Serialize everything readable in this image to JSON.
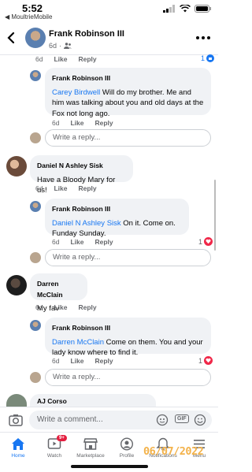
{
  "status": {
    "time": "5:52",
    "back_app": "◀ MoultrieMobile"
  },
  "header": {
    "name": "Frank Robinson III",
    "time": "6d"
  },
  "top_actions": {
    "time": "6d",
    "like": "Like",
    "reply": "Reply",
    "count": "1"
  },
  "comments": [
    {
      "author": "Frank Robinson III",
      "tag": "Carey Birdwell",
      "text": "Will do my brother. Me and him was talking about you and old days at the Fox not long ago.",
      "time": "6d",
      "like": "Like",
      "reply": "Reply"
    },
    {
      "author": "Daniel N Ashley Sisk",
      "text": "Have a Bloody Mary for us!",
      "time": "6d",
      "like": "Like",
      "reply": "Reply"
    },
    {
      "author": "Frank Robinson III",
      "tag": "Daniel N Ashley Sisk",
      "text": "On it. Come on. Funday Sunday.",
      "time": "6d",
      "like": "Like",
      "reply": "Reply",
      "count": "1"
    },
    {
      "author": "Darren McClain",
      "text": "My fav",
      "time": "6d",
      "like": "Like",
      "reply": "Reply"
    },
    {
      "author": "Frank Robinson III",
      "tag": "Darren McClain",
      "text": "Come on them. You and your lady know where to find it.",
      "time": "6d",
      "like": "Like",
      "reply": "Reply",
      "count": "1"
    },
    {
      "author": "AJ Corso"
    }
  ],
  "reply_placeholder": "Write a reply...",
  "comment_placeholder": "Write a comment...",
  "gif_label": "GIF",
  "tabs": [
    {
      "label": "Home",
      "icon": "home-icon"
    },
    {
      "label": "Watch",
      "icon": "watch-icon",
      "badge": "9+"
    },
    {
      "label": "Marketplace",
      "icon": "marketplace-icon"
    },
    {
      "label": "Profile",
      "icon": "profile-icon"
    },
    {
      "label": "Notifications",
      "icon": "bell-icon"
    },
    {
      "label": "Menu",
      "icon": "menu-icon"
    }
  ],
  "date_stamp": "06/07/2022",
  "colors": {
    "accent": "#1877f2",
    "bubble": "#f0f2f5",
    "heart": "#f02849",
    "date": "#f3b24a"
  }
}
